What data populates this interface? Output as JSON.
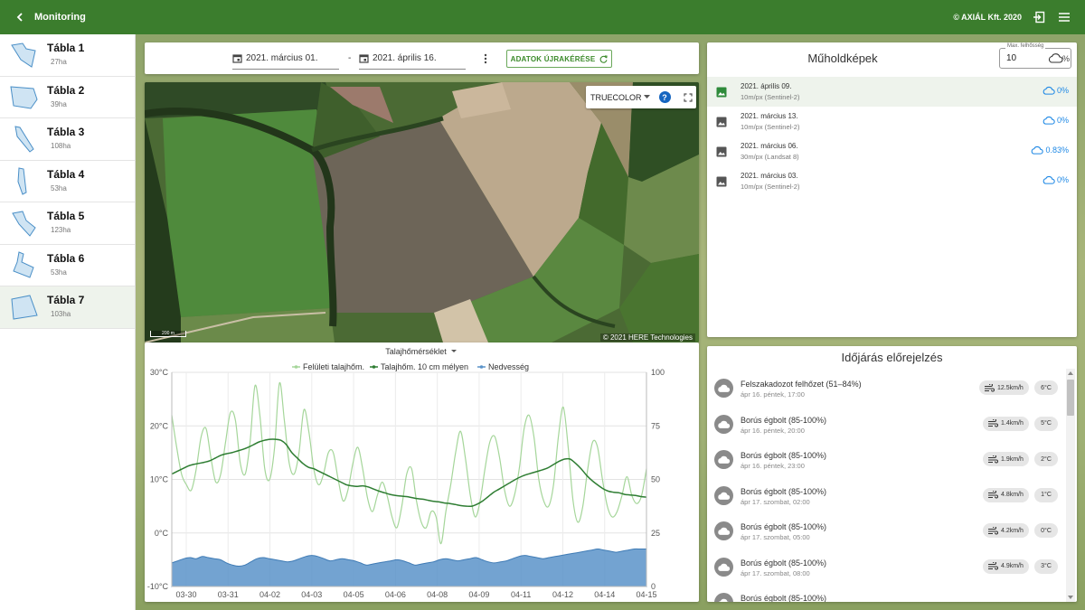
{
  "topbar": {
    "title": "Monitoring",
    "copyright": "© AXIÁL Kft. 2020"
  },
  "sidebar": {
    "fields": [
      {
        "name": "Tábla 1",
        "area": "27ha"
      },
      {
        "name": "Tábla 2",
        "area": "39ha"
      },
      {
        "name": "Tábla 3",
        "area": "108ha"
      },
      {
        "name": "Tábla 4",
        "area": "53ha"
      },
      {
        "name": "Tábla 5",
        "area": "123ha"
      },
      {
        "name": "Tábla 6",
        "area": "53ha"
      },
      {
        "name": "Tábla 7",
        "area": "103ha"
      }
    ],
    "active_index": 6
  },
  "datebar": {
    "from": "2021. március 01.",
    "separator": "-",
    "to": "2021. április 16.",
    "reload_label": "ADATOK ÚJRAKÉRÉSE"
  },
  "map": {
    "layer": "TRUECOLOR",
    "help": "?",
    "attribution": "© 2021 HERE Technologies",
    "scale": "200 m"
  },
  "chart_data": {
    "type": "line",
    "title": "Talajhőmérséklet",
    "series": [
      {
        "name": "Felületi talajhőm.",
        "color": "#a5d69a",
        "axis": "left",
        "unit": "°C",
        "values": [
          22,
          16,
          11,
          9,
          8,
          12,
          18,
          19.5,
          14,
          9.5,
          11,
          17,
          22.5,
          21,
          13,
          11,
          17,
          27.5,
          22,
          12,
          10,
          16,
          28,
          21,
          13,
          11,
          15,
          23,
          19,
          12,
          9,
          11,
          15,
          15,
          10,
          6,
          8,
          13,
          16,
          12,
          6.5,
          4,
          7,
          9.5,
          7,
          3,
          1,
          5,
          11,
          12,
          6,
          2,
          1,
          4,
          3,
          -2,
          4,
          9,
          15,
          19,
          14,
          7,
          3,
          6,
          12,
          17,
          18,
          14,
          8,
          5,
          7,
          12,
          19.5,
          22,
          18,
          10,
          6,
          5,
          9,
          18,
          23.5,
          16,
          6,
          2,
          5,
          12,
          17,
          16,
          10,
          5,
          3,
          4,
          7,
          10.5,
          7,
          5.5,
          7,
          12
        ]
      },
      {
        "name": "Talajhőm. 10 cm mélyen",
        "color": "#2e7d32",
        "axis": "left",
        "unit": "°C",
        "values": [
          11,
          11.5,
          12,
          12.5,
          12.8,
          13,
          13.2,
          13.5,
          14,
          14.5,
          14.8,
          15,
          15.3,
          15.6,
          16,
          16.5,
          17,
          17.3,
          17.5,
          17.5,
          17.3,
          16.5,
          15,
          14,
          13,
          12.3,
          12,
          11.5,
          11,
          10.5,
          10,
          9.5,
          9,
          8.8,
          8.7,
          8.8,
          8.6,
          8.2,
          7.8,
          7.5,
          7.2,
          7,
          6.9,
          6.8,
          6.6,
          6.4,
          6.3,
          6.1,
          5.9,
          5.8,
          5.6,
          5.5,
          5.3,
          5.1,
          5,
          5,
          5.4,
          6,
          6.8,
          7.6,
          8.2,
          8.8,
          9.4,
          10,
          10.5,
          10.9,
          11.2,
          11.5,
          11.8,
          12.2,
          12.8,
          13.4,
          13.8,
          13.8,
          13,
          12,
          10.8,
          9.8,
          9,
          8.3,
          7.8,
          7.6,
          7.5,
          7.2,
          7.1,
          7,
          6.8,
          6.7
        ]
      },
      {
        "name": "Nedvesség",
        "color": "#5b93c9",
        "axis": "right",
        "unit": "",
        "values": [
          11,
          12,
          13,
          13.5,
          13,
          14,
          13.5,
          13,
          12.5,
          11,
          10,
          9.5,
          10,
          11.5,
          13,
          13.5,
          13,
          12.5,
          12,
          11.5,
          12,
          13,
          14,
          14.5,
          14,
          13,
          12,
          12.5,
          13,
          12.5,
          12,
          11,
          10,
          10.5,
          11,
          11.5,
          12,
          12.5,
          12,
          11,
          10,
          10.5,
          11,
          11.5,
          12.5,
          13,
          12.5,
          12,
          12.5,
          13,
          13.5,
          12.5,
          11.5,
          11,
          11.5,
          12,
          13,
          14,
          14.5,
          14,
          13.5,
          13,
          13.5,
          14,
          14.5,
          15,
          15.5,
          16,
          16.5,
          17,
          17.5,
          17,
          16.5,
          16,
          16.5,
          17,
          17.5,
          17.5,
          17.5
        ]
      }
    ],
    "x_ticks": [
      "03-30",
      "03-31",
      "04-02",
      "04-03",
      "04-05",
      "04-06",
      "04-08",
      "04-09",
      "04-11",
      "04-12",
      "04-14",
      "04-15"
    ],
    "y_left": {
      "ticks": [
        "30°C",
        "20°C",
        "10°C",
        "0°C",
        "-10°C"
      ],
      "range": [
        -10,
        30
      ]
    },
    "y_right": {
      "ticks": [
        "100",
        "75",
        "50",
        "25",
        "0"
      ],
      "range": [
        0,
        100
      ]
    },
    "grid": true,
    "legend_position": "top"
  },
  "satellite": {
    "title": "Műholdképek",
    "cloud_max_label": "Max. felhősség",
    "cloud_max_value": "10",
    "cloud_max_unit": "%",
    "images": [
      {
        "date": "2021. április 09.",
        "resolution": "10m/px (Sentinel-2)",
        "cloud": "0%"
      },
      {
        "date": "2021. március 13.",
        "resolution": "10m/px (Sentinel-2)",
        "cloud": "0%"
      },
      {
        "date": "2021. március 06.",
        "resolution": "30m/px (Landsat 8)",
        "cloud": "0.83%"
      },
      {
        "date": "2021. március 03.",
        "resolution": "10m/px (Sentinel-2)",
        "cloud": "0%"
      }
    ]
  },
  "weather": {
    "title": "Időjárás előrejelzés",
    "forecasts": [
      {
        "desc": "Felszakadozot felhőzet (51–84%)",
        "time": "ápr 16. péntek, 17:00",
        "wind": "12.5km/h",
        "temp": "6°C"
      },
      {
        "desc": "Borús égbolt (85-100%)",
        "time": "ápr 16. péntek, 20:00",
        "wind": "1.4km/h",
        "temp": "5°C"
      },
      {
        "desc": "Borús égbolt (85-100%)",
        "time": "ápr 16. péntek, 23:00",
        "wind": "1.9km/h",
        "temp": "2°C"
      },
      {
        "desc": "Borús égbolt (85-100%)",
        "time": "ápr 17. szombat, 02:00",
        "wind": "4.8km/h",
        "temp": "1°C"
      },
      {
        "desc": "Borús égbolt (85-100%)",
        "time": "ápr 17. szombat, 05:00",
        "wind": "4.2km/h",
        "temp": "0°C"
      },
      {
        "desc": "Borús égbolt (85-100%)",
        "time": "ápr 17. szombat, 08:00",
        "wind": "4.9km/h",
        "temp": "3°C"
      },
      {
        "desc": "Borús égbolt (85-100%)",
        "time": "",
        "wind": "",
        "temp": ""
      }
    ]
  }
}
